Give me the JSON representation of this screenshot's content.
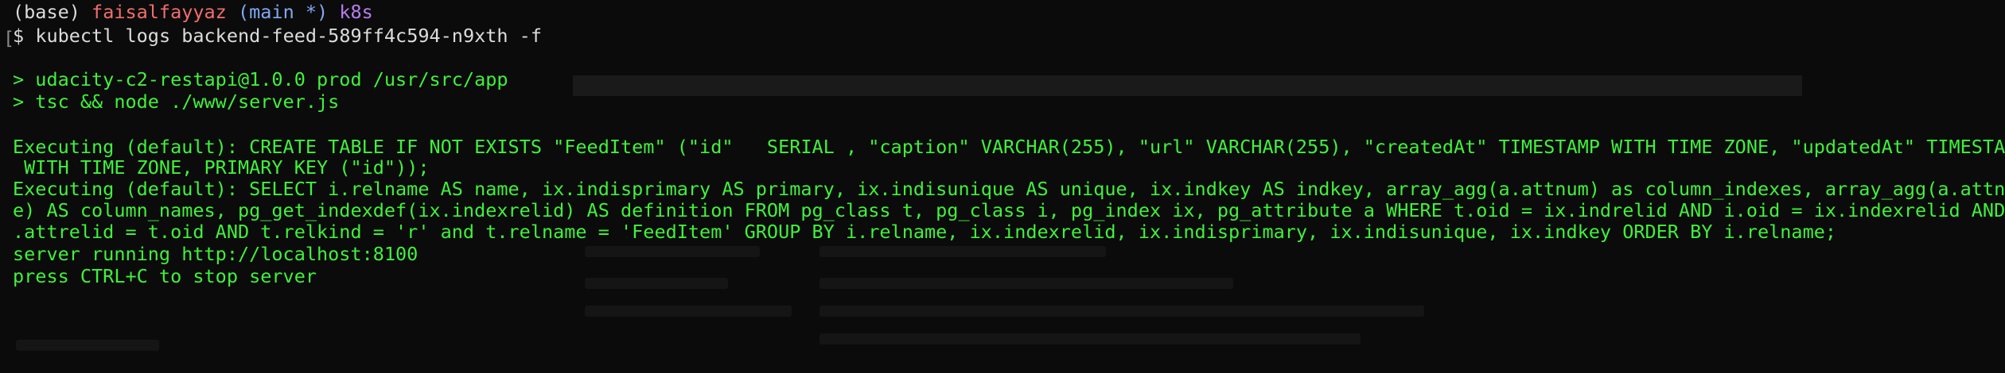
{
  "prompt": {
    "env": "(base)",
    "user": "faisalfayyaz",
    "branch": "(main *)",
    "kube_context": "k8s",
    "symbol": "$",
    "command": "kubectl logs backend-feed-589ff4c594-n9xth -f"
  },
  "output": {
    "npm_line_1": "> udacity-c2-restapi@1.0.0 prod /usr/src/app",
    "npm_line_2": "> tsc && node ./www/server.js",
    "sql_1_line_1": "Executing (default): CREATE TABLE IF NOT EXISTS \"FeedItem\" (\"id\"   SERIAL , \"caption\" VARCHAR(255), \"url\" VARCHAR(255), \"createdAt\" TIMESTAMP WITH TIME ZONE, \"updatedAt\" TIMESTAMP",
    "sql_1_line_2": " WITH TIME ZONE, PRIMARY KEY (\"id\"));",
    "sql_2_line_1": "Executing (default): SELECT i.relname AS name, ix.indisprimary AS primary, ix.indisunique AS unique, ix.indkey AS indkey, array_agg(a.attnum) as column_indexes, array_agg(a.attnam",
    "sql_2_line_2": "e) AS column_names, pg_get_indexdef(ix.indexrelid) AS definition FROM pg_class t, pg_class i, pg_index ix, pg_attribute a WHERE t.oid = ix.indrelid AND i.oid = ix.indexrelid AND a",
    "sql_2_line_3": ".attrelid = t.oid AND t.relkind = 'r' and t.relname = 'FeedItem' GROUP BY i.relname, ix.indexrelid, ix.indisprimary, ix.indisunique, ix.indkey ORDER BY i.relname;",
    "server_running": "server running http://localhost:8100",
    "stop_hint": "press CTRL+C to stop server"
  },
  "colors": {
    "background": "#0b0b0b",
    "output_text": "#3ff23a",
    "prompt_text": "#dcdcdc",
    "user": "#f26d6d",
    "branch": "#7ea8f2",
    "kube_context": "#b77ef2"
  }
}
